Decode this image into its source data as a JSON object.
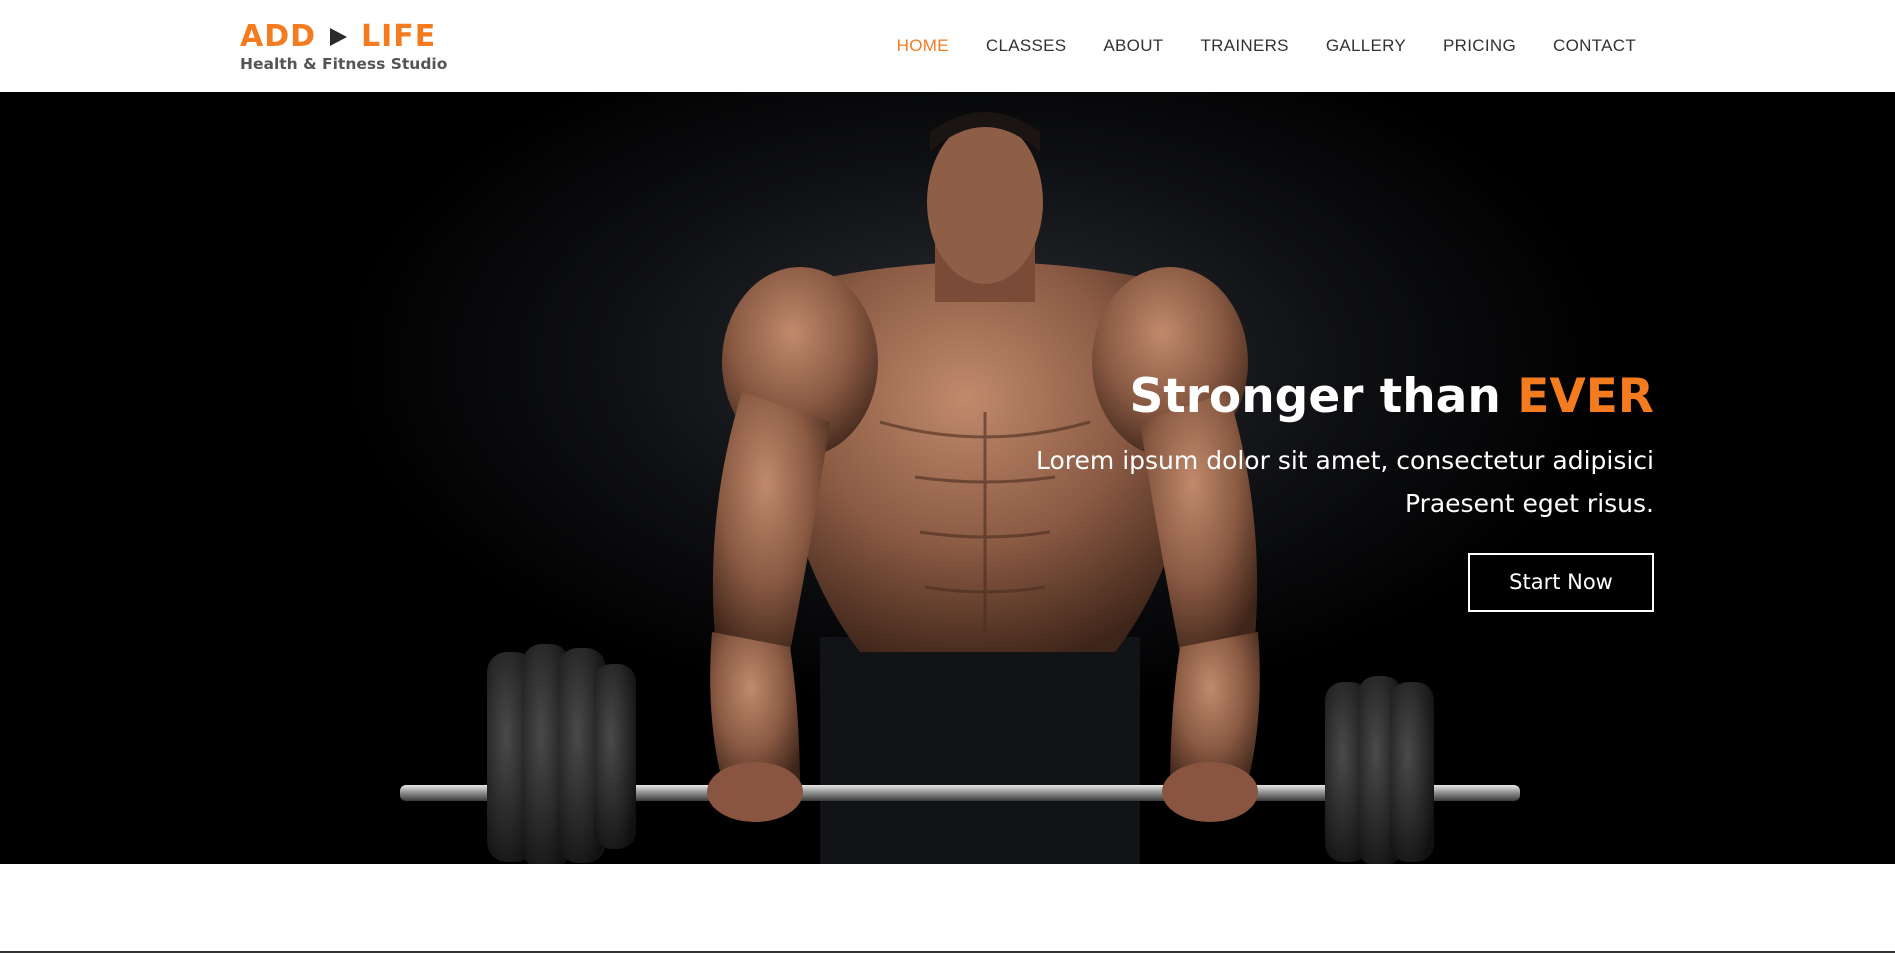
{
  "brand": {
    "name_left": "ADD",
    "name_right": "LIFE",
    "tagline": "Health & Fitness Studio",
    "accent_color": "#f47b20"
  },
  "nav": {
    "items": [
      {
        "label": "HOME",
        "active": true
      },
      {
        "label": "CLASSES",
        "active": false
      },
      {
        "label": "ABOUT",
        "active": false
      },
      {
        "label": "TRAINERS",
        "active": false
      },
      {
        "label": "GALLERY",
        "active": false
      },
      {
        "label": "PRICING",
        "active": false
      },
      {
        "label": "CONTACT",
        "active": false
      }
    ]
  },
  "hero": {
    "title_main": "Stronger than ",
    "title_accent": "EVER",
    "text": "Lorem ipsum dolor sit amet, consectetur adipisici Praesent eget risus.",
    "cta_label": "Start Now",
    "image": "man-lifting-barbell-photo"
  }
}
